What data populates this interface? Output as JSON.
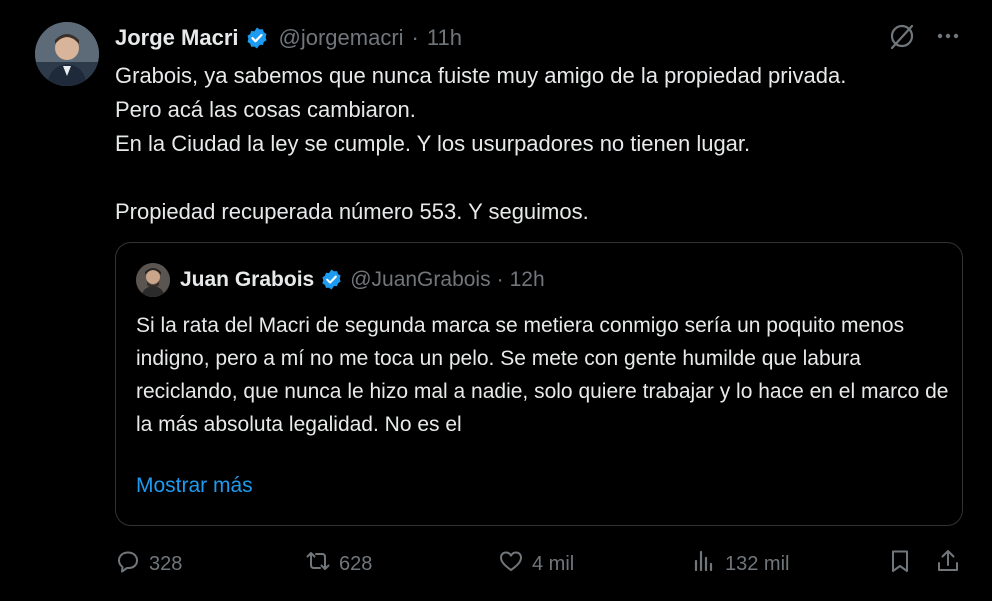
{
  "tweet": {
    "author_name": "Jorge Macri",
    "handle": "@jorgemacri",
    "separator": "·",
    "time": "11h",
    "text": "Grabois, ya sabemos que nunca fuiste muy amigo de la propiedad privada.\nPero acá las cosas cambiaron.\nEn la Ciudad la ley se cumple. Y los usurpadores no tienen lugar.\n\nPropiedad recuperada número 553. Y seguimos."
  },
  "quoted": {
    "author_name": "Juan Grabois",
    "handle": "@JuanGrabois",
    "separator": "·",
    "time": "12h",
    "text": "Si la rata del Macri de segunda marca se metiera conmigo sería un poquito menos indigno, pero a mí no me toca un pelo. Se mete con gente humilde que labura reciclando, que nunca le hizo mal a nadie, solo quiere trabajar y lo hace en el marco de la más absoluta legalidad. No es el",
    "show_more": "Mostrar más"
  },
  "actions": {
    "replies": "328",
    "reposts": "628",
    "likes": "4 mil",
    "views": "132 mil"
  },
  "colors": {
    "background": "#000000",
    "text": "#e7e9ea",
    "secondary": "#71767b",
    "accent": "#1d9bf0",
    "border": "#2f3336"
  },
  "icons": [
    "grok-icon",
    "more-icon",
    "verified-icon",
    "reply-icon",
    "repost-icon",
    "like-icon",
    "views-icon",
    "bookmark-icon",
    "share-icon"
  ]
}
